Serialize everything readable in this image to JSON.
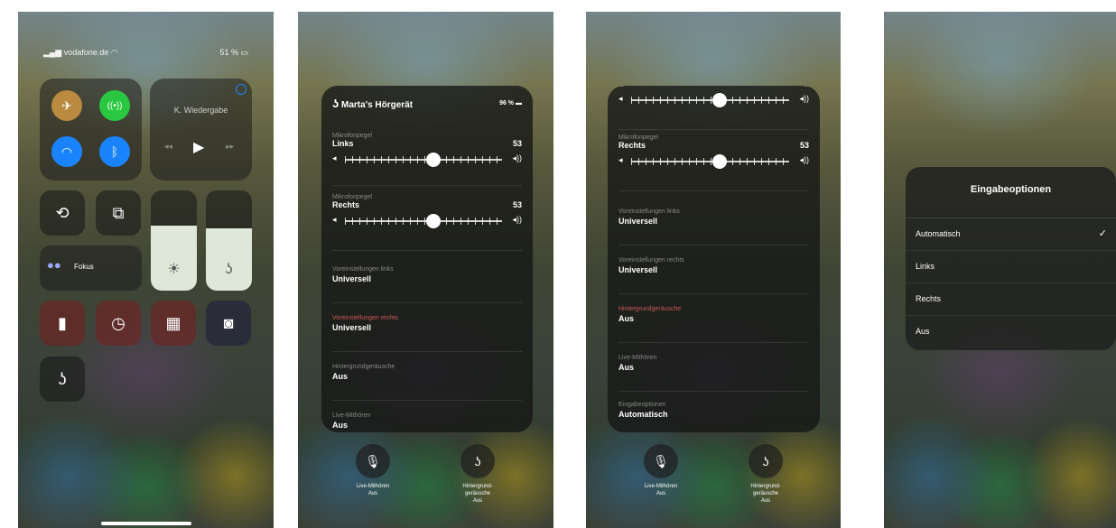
{
  "panel1": {
    "status_carrier": "vodafone.de",
    "status_battery": "51 %",
    "media_title": "K. Wiedergabe",
    "focus_label": "Fokus",
    "brightness_level": 0.65,
    "hearing_level": 0.62
  },
  "hearing": {
    "device_name": "Marta's Hörgerät",
    "device_battery": "96 %",
    "mic_label": "Mikrofonpegel",
    "left": "Links",
    "right": "Rechts",
    "left_value": "53",
    "right_value": "53",
    "preset_left_label": "Voreinstellungen links",
    "preset_right_label": "Voreinstellungen rechts",
    "preset_value": "Universell",
    "bg_noise_label": "Hintergrundgeräusche",
    "off": "Aus",
    "live_label": "Live-Mithören",
    "input_label": "Eingabeoptionen",
    "input_value": "Automatisch",
    "bottom_live_title": "Live-Mithören",
    "bottom_live_value": "Aus",
    "bottom_bg_title_1": "Hintergrund-",
    "bottom_bg_title_2": "geräusche",
    "bottom_bg_value": "Aus"
  },
  "options": {
    "title": "Eingabeoptionen",
    "items": [
      "Automatisch",
      "Links",
      "Rechts",
      "Aus"
    ],
    "checkmark": "✓"
  },
  "colors": {
    "accent_green": "#28c840",
    "accent_blue": "#1a84ff",
    "control_orange": "#c08a3a",
    "label_red": "#c85a55"
  }
}
